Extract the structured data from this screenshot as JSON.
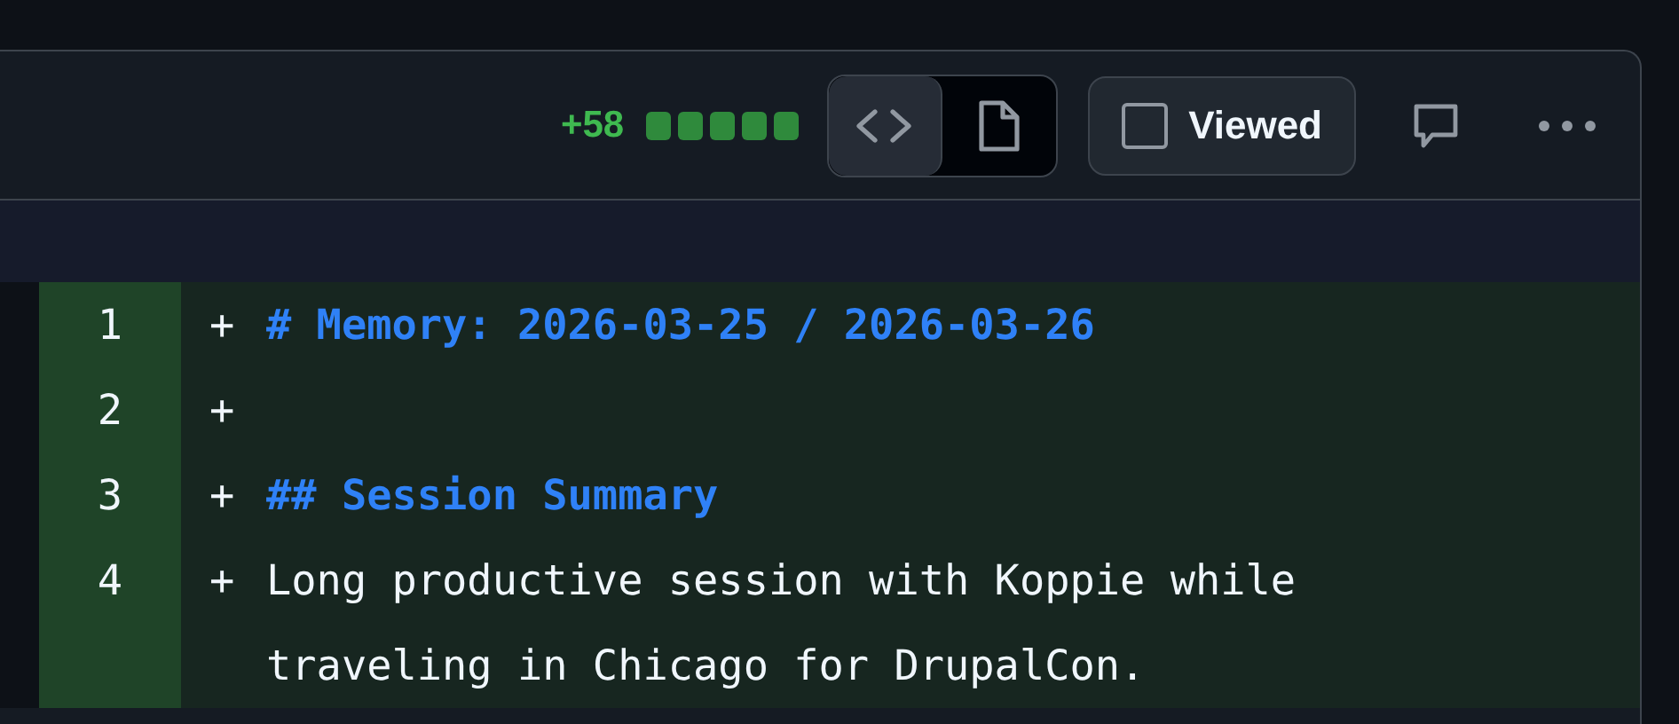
{
  "file_header": {
    "additions": "+58",
    "view_toggle": [
      {
        "kind": "code",
        "selected": false
      },
      {
        "kind": "file",
        "selected": true
      }
    ],
    "viewed": {
      "label": "Viewed",
      "checked": false
    }
  },
  "lines": [
    {
      "number": "1",
      "sign": "+",
      "kind": "heading",
      "text": "# Memory: 2026-03-25 / 2026-03-26"
    },
    {
      "number": "2",
      "sign": "+",
      "kind": "blank"
    },
    {
      "number": "3",
      "sign": "+",
      "kind": "heading",
      "text": "## Session Summary"
    },
    {
      "number": "4",
      "sign": "+",
      "kind": "text",
      "text": "Long productive session with Koppie while traveling in Chicago for DrupalCon."
    }
  ]
}
